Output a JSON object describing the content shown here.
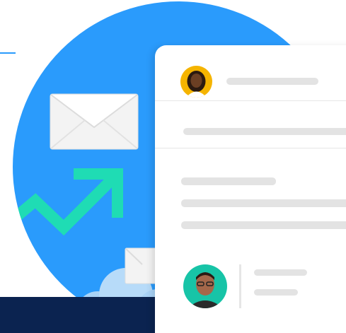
{
  "colors": {
    "circle_blue": "#2a9bfc",
    "arrow_teal": "#1fdcb4",
    "navy": "#0b2350",
    "placeholder_gray": "#e3e3e3",
    "avatar_top_bg": "#f5b400",
    "avatar_bottom_bg": "#17c4a7"
  },
  "icons": [
    "envelope-icon",
    "trend-arrow-icon",
    "cloud-icon",
    "avatar-woman",
    "avatar-man"
  ]
}
